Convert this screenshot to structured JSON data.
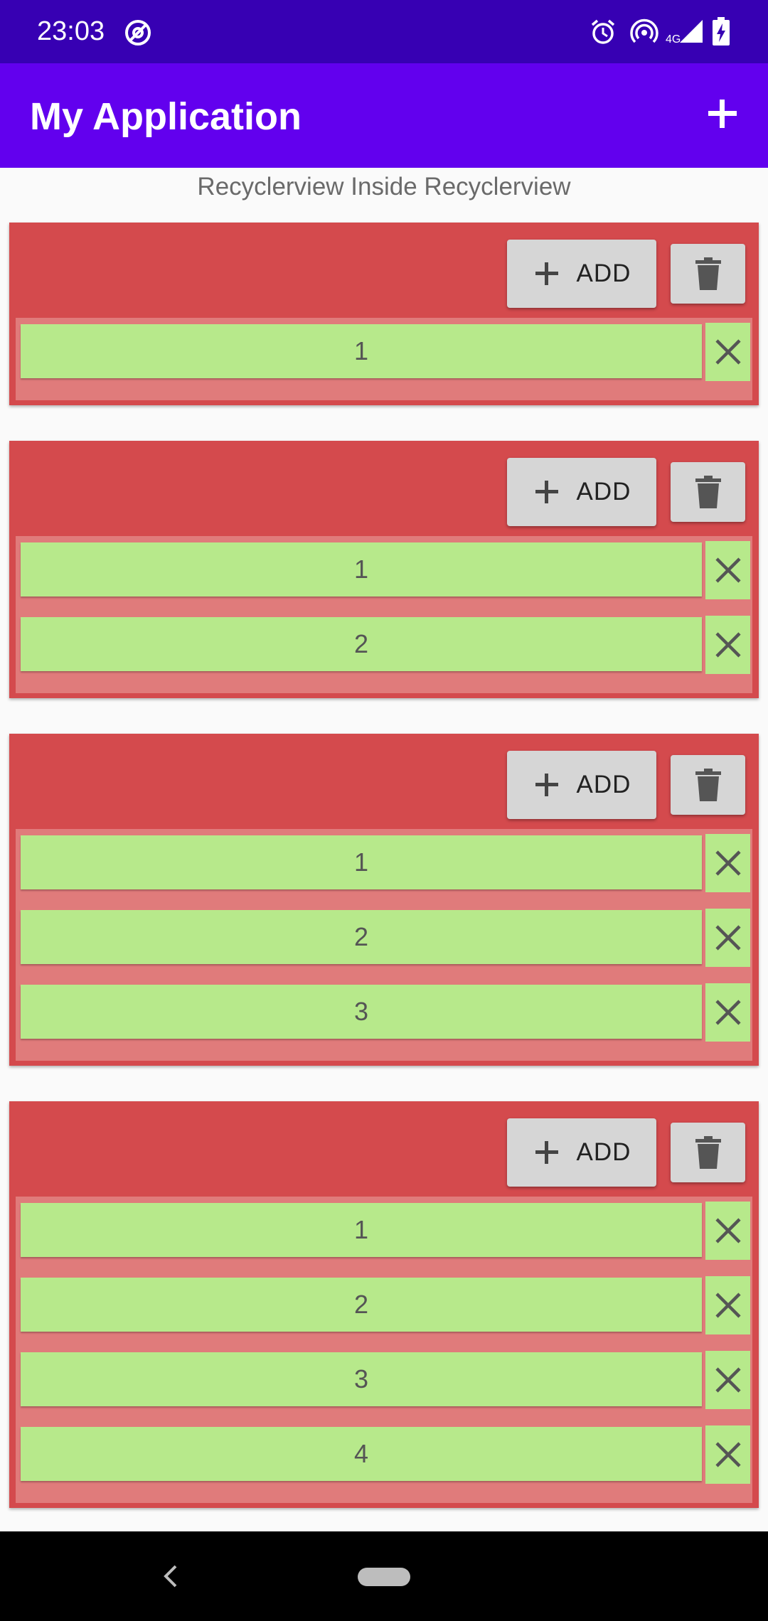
{
  "status_bar": {
    "time": "23:03",
    "icons": [
      "at-sign-icon",
      "alarm-icon",
      "hotspot-icon",
      "signal-4g-icon",
      "battery-charging-icon"
    ]
  },
  "app_bar": {
    "title": "My Application",
    "add_icon": "plus-icon"
  },
  "subtitle": "Recyclerview Inside Recyclerview",
  "colors": {
    "status_bar": "#3700b3",
    "app_bar": "#6200ee",
    "card": "#d44a4d",
    "card_inner": "#e07b7b",
    "item": "#b7e98b",
    "button": "#d6d6d6"
  },
  "groups": [
    {
      "add_label": "ADD",
      "items": [
        "1"
      ]
    },
    {
      "add_label": "ADD",
      "items": [
        "1",
        "2"
      ]
    },
    {
      "add_label": "ADD",
      "items": [
        "1",
        "2",
        "3"
      ]
    },
    {
      "add_label": "ADD",
      "items": [
        "1",
        "2",
        "3",
        "4"
      ]
    }
  ],
  "nav_bar": {
    "back_icon": "back-chevron-icon",
    "home_icon": "home-pill-icon"
  }
}
